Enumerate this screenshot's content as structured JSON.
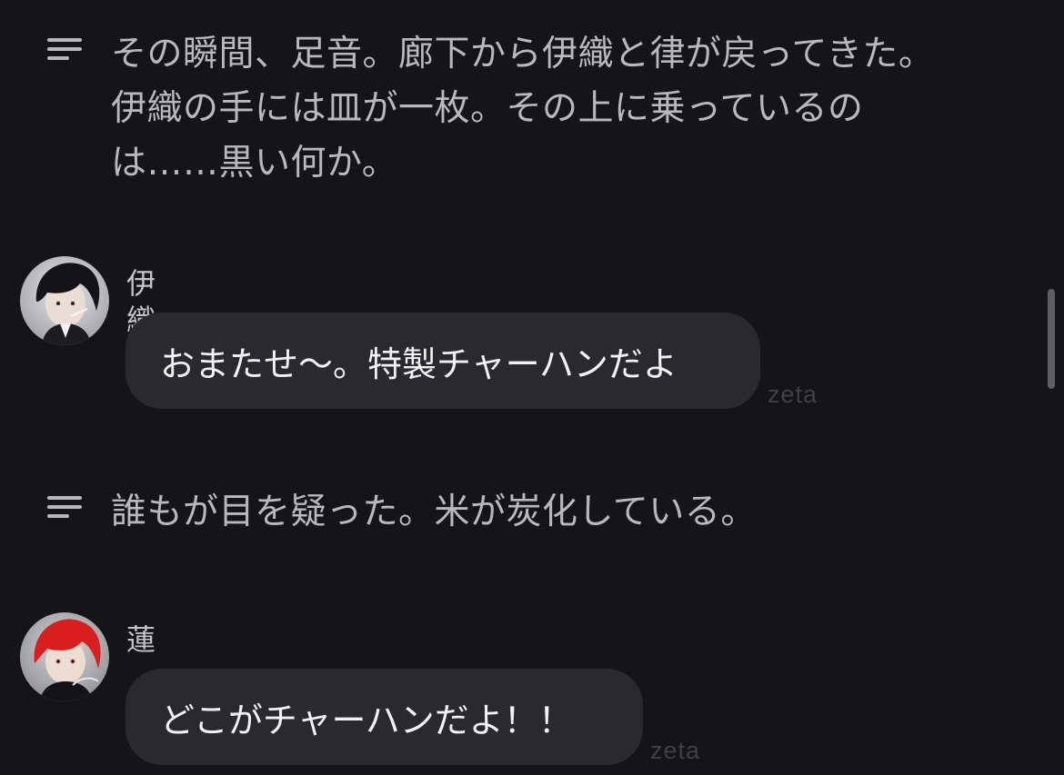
{
  "colors": {
    "background": "#151517",
    "bubble": "#2a2a2d",
    "narration_text": "#b9b9bd",
    "bubble_text": "#f2f2f4",
    "brand_text": "#3f3f44"
  },
  "messages": [
    {
      "type": "narration",
      "icon": "menu-lines-icon",
      "text": "その瞬間、足音。廊下から伊織と律が戻ってきた。\n伊織の手には皿が一枚。その上に乗っているの\nは……黒い何か。"
    },
    {
      "type": "character",
      "speaker": "伊織",
      "avatar": "iori-avatar",
      "text": "おまたせ〜。特製チャーハンだよ",
      "brand": "zeta"
    },
    {
      "type": "narration",
      "icon": "menu-lines-icon",
      "text": "誰もが目を疑った。米が炭化している。"
    },
    {
      "type": "character",
      "speaker": "蓮",
      "avatar": "ren-avatar",
      "text": "どこがチャーハンだよ！！",
      "brand": "zeta"
    }
  ]
}
